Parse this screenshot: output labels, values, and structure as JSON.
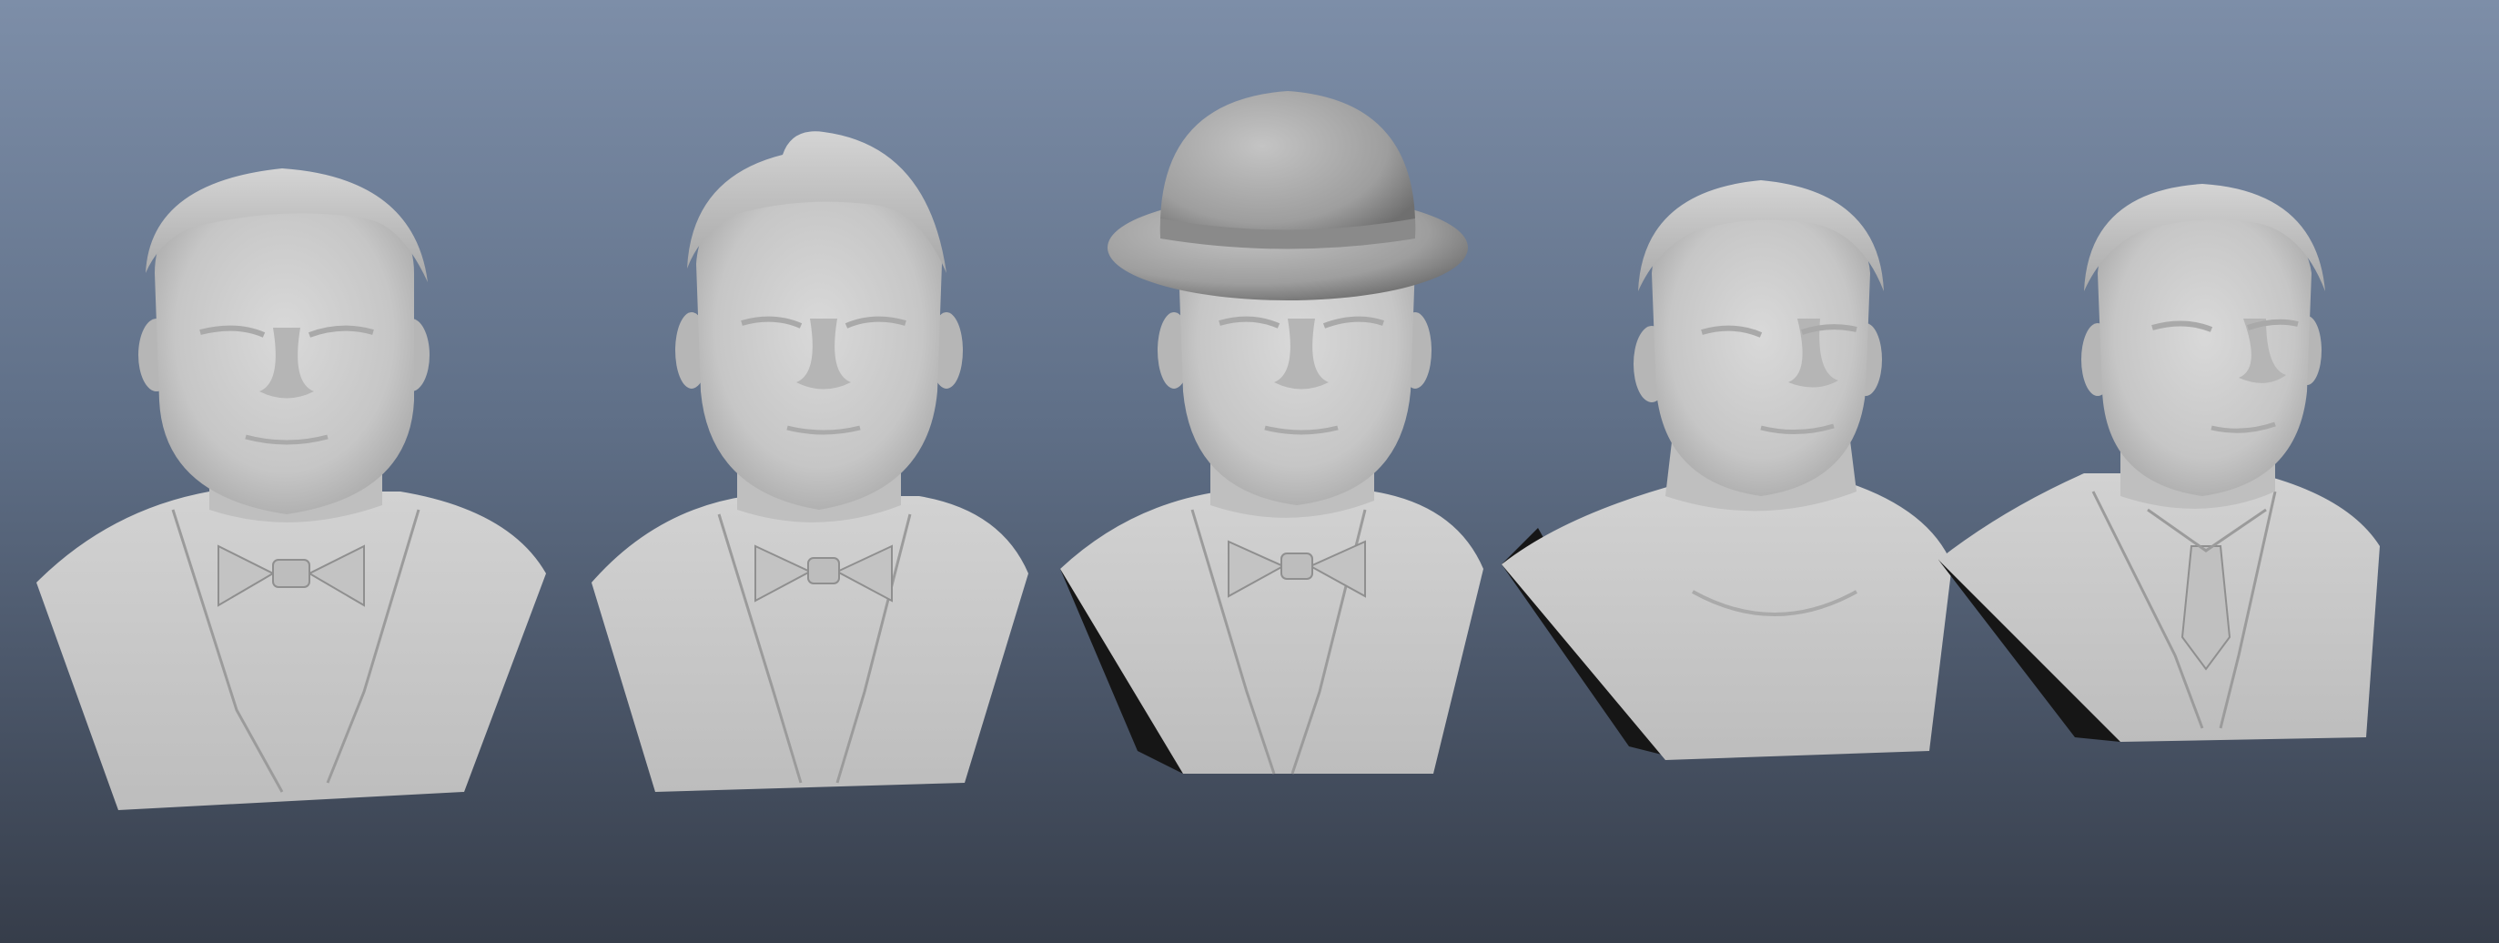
{
  "viewport": {
    "background_top": "#7b8ca6",
    "background_bottom": "#3a4250",
    "clay_color": "#c9c9c9",
    "shadow_side_color": "#141414"
  },
  "busts": [
    {
      "id": 1,
      "hair": "short-side-part",
      "attire": "suit-with-bow-tie",
      "hat": "none",
      "dark_side": false
    },
    {
      "id": 2,
      "hair": "pompadour",
      "attire": "suit-with-bow-tie",
      "hat": "none",
      "dark_side": false
    },
    {
      "id": 3,
      "hair": "hidden",
      "attire": "suit-with-bow-tie",
      "hat": "bowler-hat",
      "dark_side": true
    },
    {
      "id": 4,
      "hair": "short-side-part",
      "attire": "bare-shoulders",
      "hat": "none",
      "dark_side": true
    },
    {
      "id": 5,
      "hair": "short-side-part",
      "attire": "suit-with-necktie",
      "hat": "none",
      "dark_side": true
    }
  ]
}
